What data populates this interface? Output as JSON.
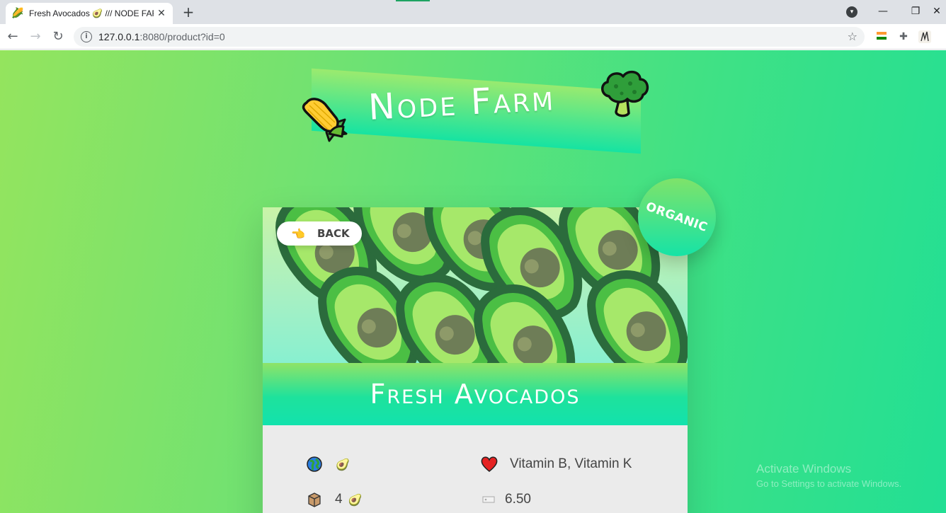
{
  "browser": {
    "tab_title": "Fresh Avocados 🥑 /// NODE FARM",
    "tab_favicon": "🌽",
    "tab_close": "✕",
    "new_tab": "+",
    "url_host": "127.0.0.1",
    "url_rest": ":8080/product?id=0",
    "win_minimize": "—",
    "win_restore": "❐",
    "win_close": "✕"
  },
  "page": {
    "logo_text": "Node Farm",
    "back_label": "BACK",
    "badge_text": "ORGANIC",
    "product_name": "Fresh Avocados",
    "details": {
      "origin_emoji": "🥑",
      "nutrients": "Vitamin B, Vitamin K",
      "quantity": "4",
      "quantity_emoji": "🥑",
      "price": "6.50"
    }
  },
  "watermark": {
    "line1": "Activate Windows",
    "line2": "Go to Settings to activate Windows."
  },
  "colors": {
    "accent_green": "#22df94",
    "light_green": "#94e45e",
    "card_bg": "#ebebeb"
  },
  "icons": {
    "logo_left": "corn-icon",
    "logo_right": "broccoli-icon",
    "back": "pointing-hand-icon",
    "origin": "globe-icon",
    "nutrients": "heart-icon",
    "quantity": "box-icon",
    "price": "price-tag-icon"
  }
}
